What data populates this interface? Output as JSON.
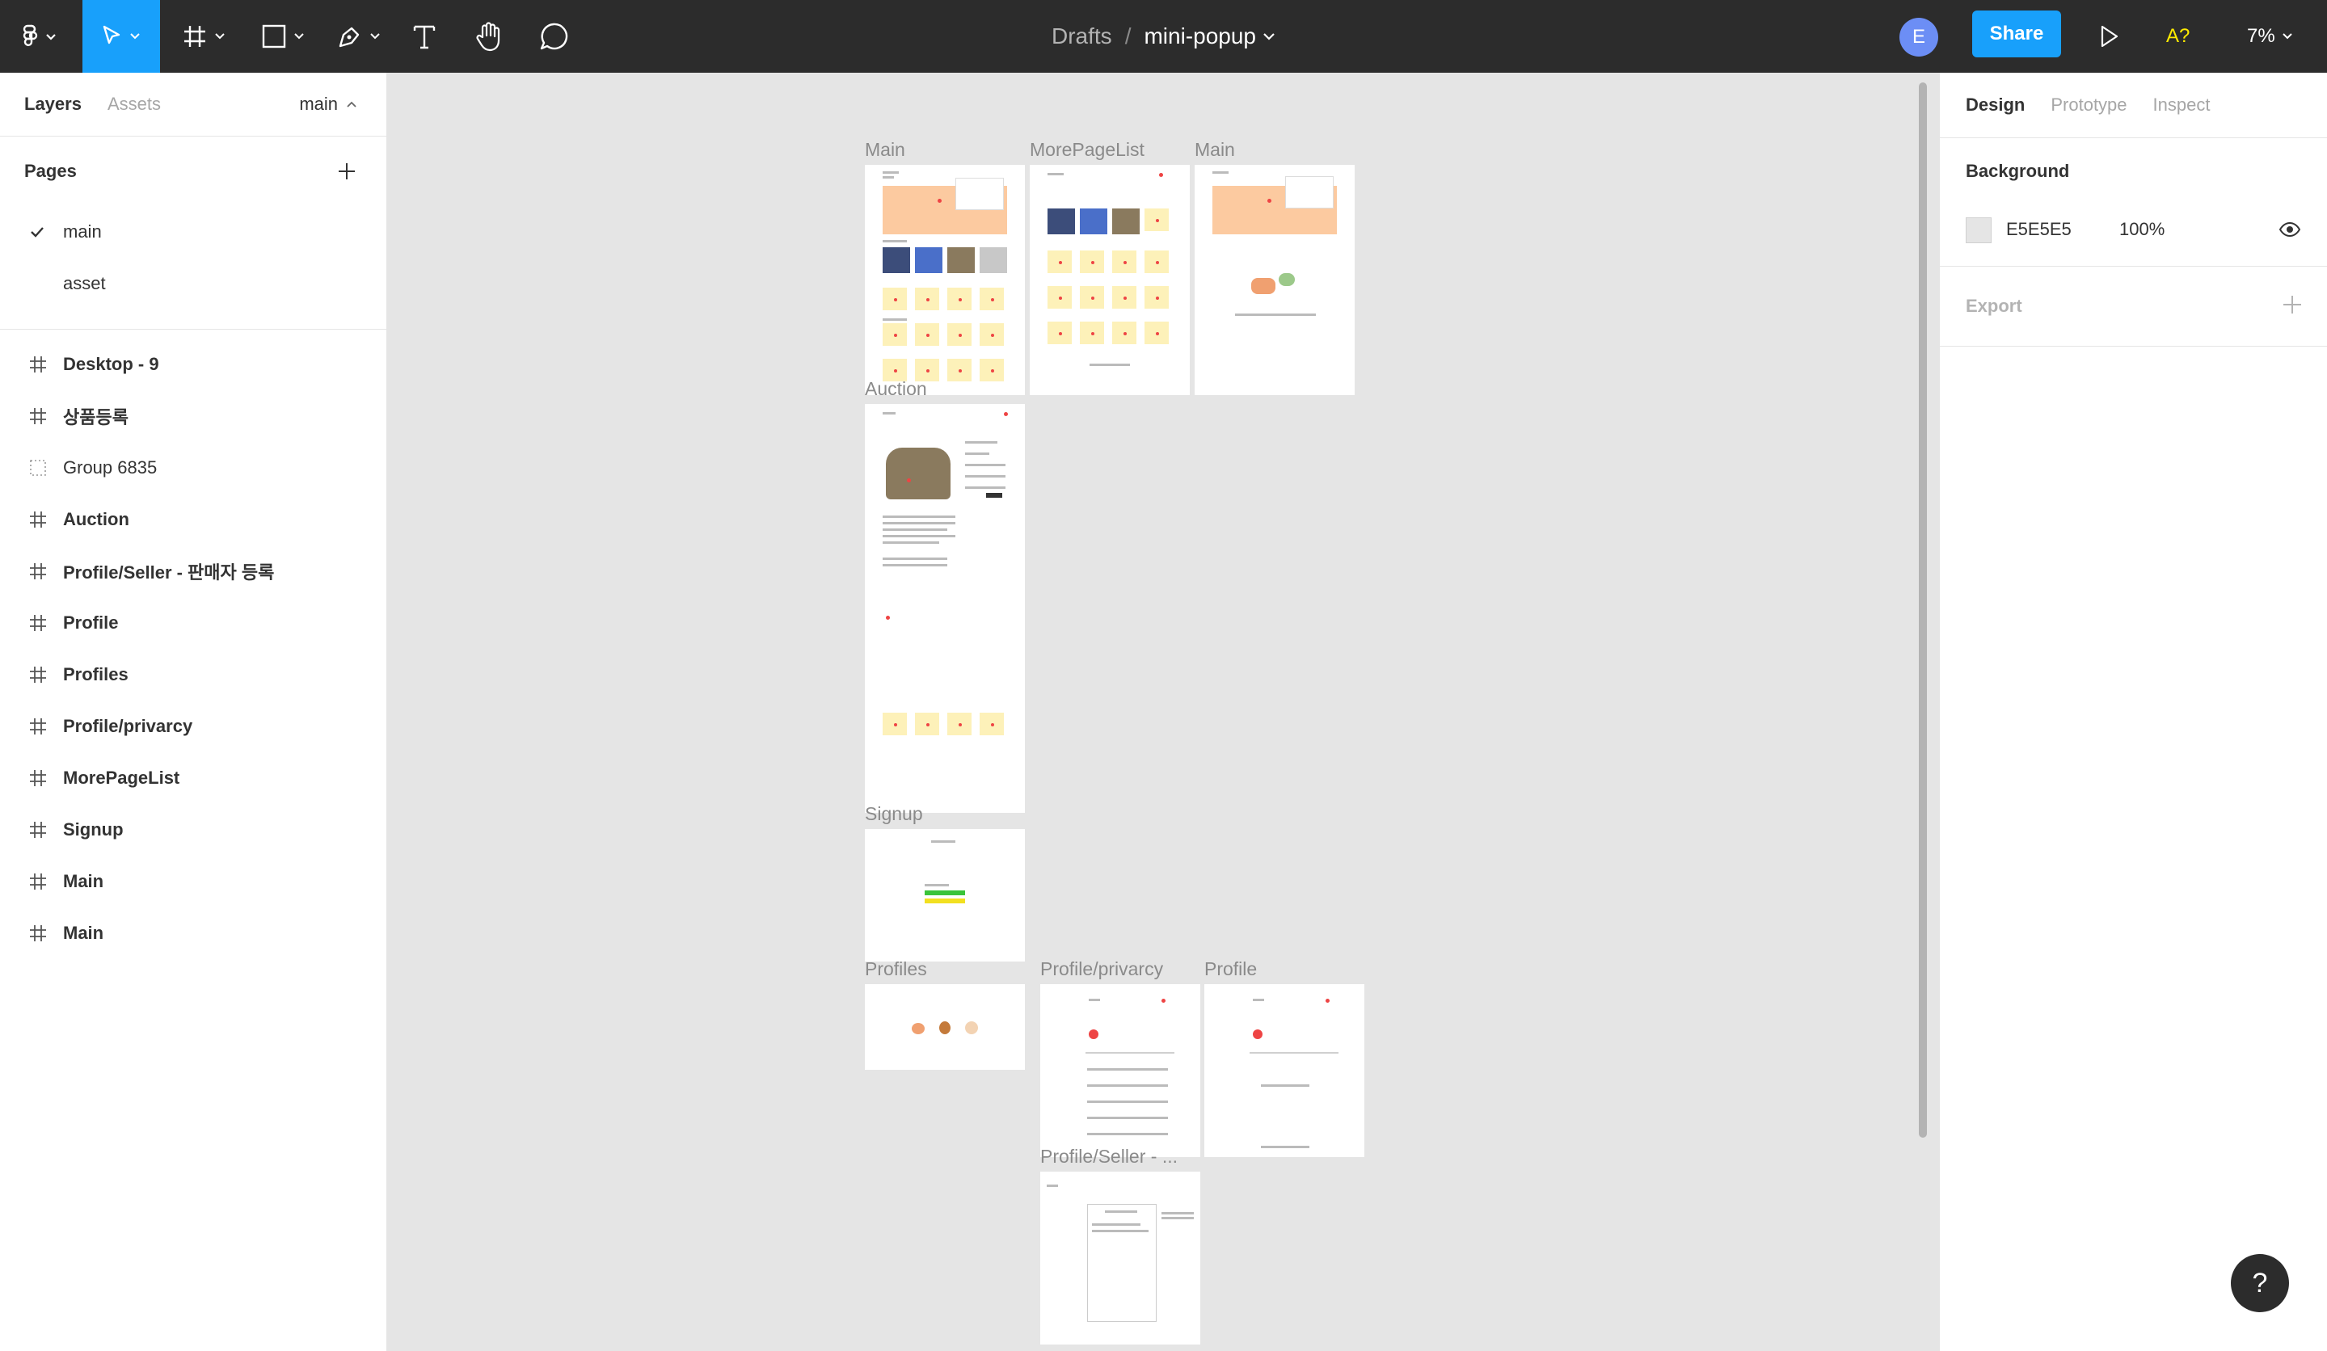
{
  "toolbar": {
    "breadcrumb_drafts": "Drafts",
    "breadcrumb_sep": "/",
    "file_name": "mini-popup",
    "avatar_initial": "E",
    "share_label": "Share",
    "a_label": "A?",
    "zoom_label": "7%",
    "icons": [
      "figma-menu-icon",
      "move-tool-icon",
      "frame-tool-icon",
      "shape-tool-icon",
      "pen-tool-icon",
      "text-tool-icon",
      "hand-tool-icon",
      "comment-tool-icon",
      "present-icon"
    ]
  },
  "left_panel": {
    "tab_layers": "Layers",
    "tab_assets": "Assets",
    "current_page": "main",
    "pages_title": "Pages",
    "pages": [
      {
        "label": "main",
        "selected": true
      },
      {
        "label": "asset",
        "selected": false
      }
    ],
    "layers": [
      {
        "label": "Desktop - 9",
        "type": "frame"
      },
      {
        "label": "상품등록",
        "type": "frame"
      },
      {
        "label": "Group 6835",
        "type": "group"
      },
      {
        "label": "Auction",
        "type": "frame"
      },
      {
        "label": "Profile/Seller - 판매자 등록",
        "type": "frame"
      },
      {
        "label": "Profile",
        "type": "frame"
      },
      {
        "label": "Profiles",
        "type": "frame"
      },
      {
        "label": "Profile/privarcy",
        "type": "frame"
      },
      {
        "label": "MorePageList",
        "type": "frame"
      },
      {
        "label": "Signup",
        "type": "frame"
      },
      {
        "label": "Main",
        "type": "frame"
      },
      {
        "label": "Main",
        "type": "frame"
      }
    ]
  },
  "canvas": {
    "frame_labels": {
      "main1": "Main",
      "morepage": "MorePageList",
      "main2": "Main",
      "auction": "Auction",
      "signup": "Signup",
      "profiles": "Profiles",
      "privacy": "Profile/privarcy",
      "profile": "Profile",
      "seller": "Profile/Seller - ..."
    }
  },
  "right_panel": {
    "tab_design": "Design",
    "tab_prototype": "Prototype",
    "tab_inspect": "Inspect",
    "background_title": "Background",
    "background_hex": "E5E5E5",
    "background_opacity": "100%",
    "export_title": "Export"
  },
  "help_label": "?",
  "colors": {
    "toolbar_bg": "#2C2C2C",
    "accent": "#18A0FB",
    "canvas_bg": "#E5E5E5"
  }
}
